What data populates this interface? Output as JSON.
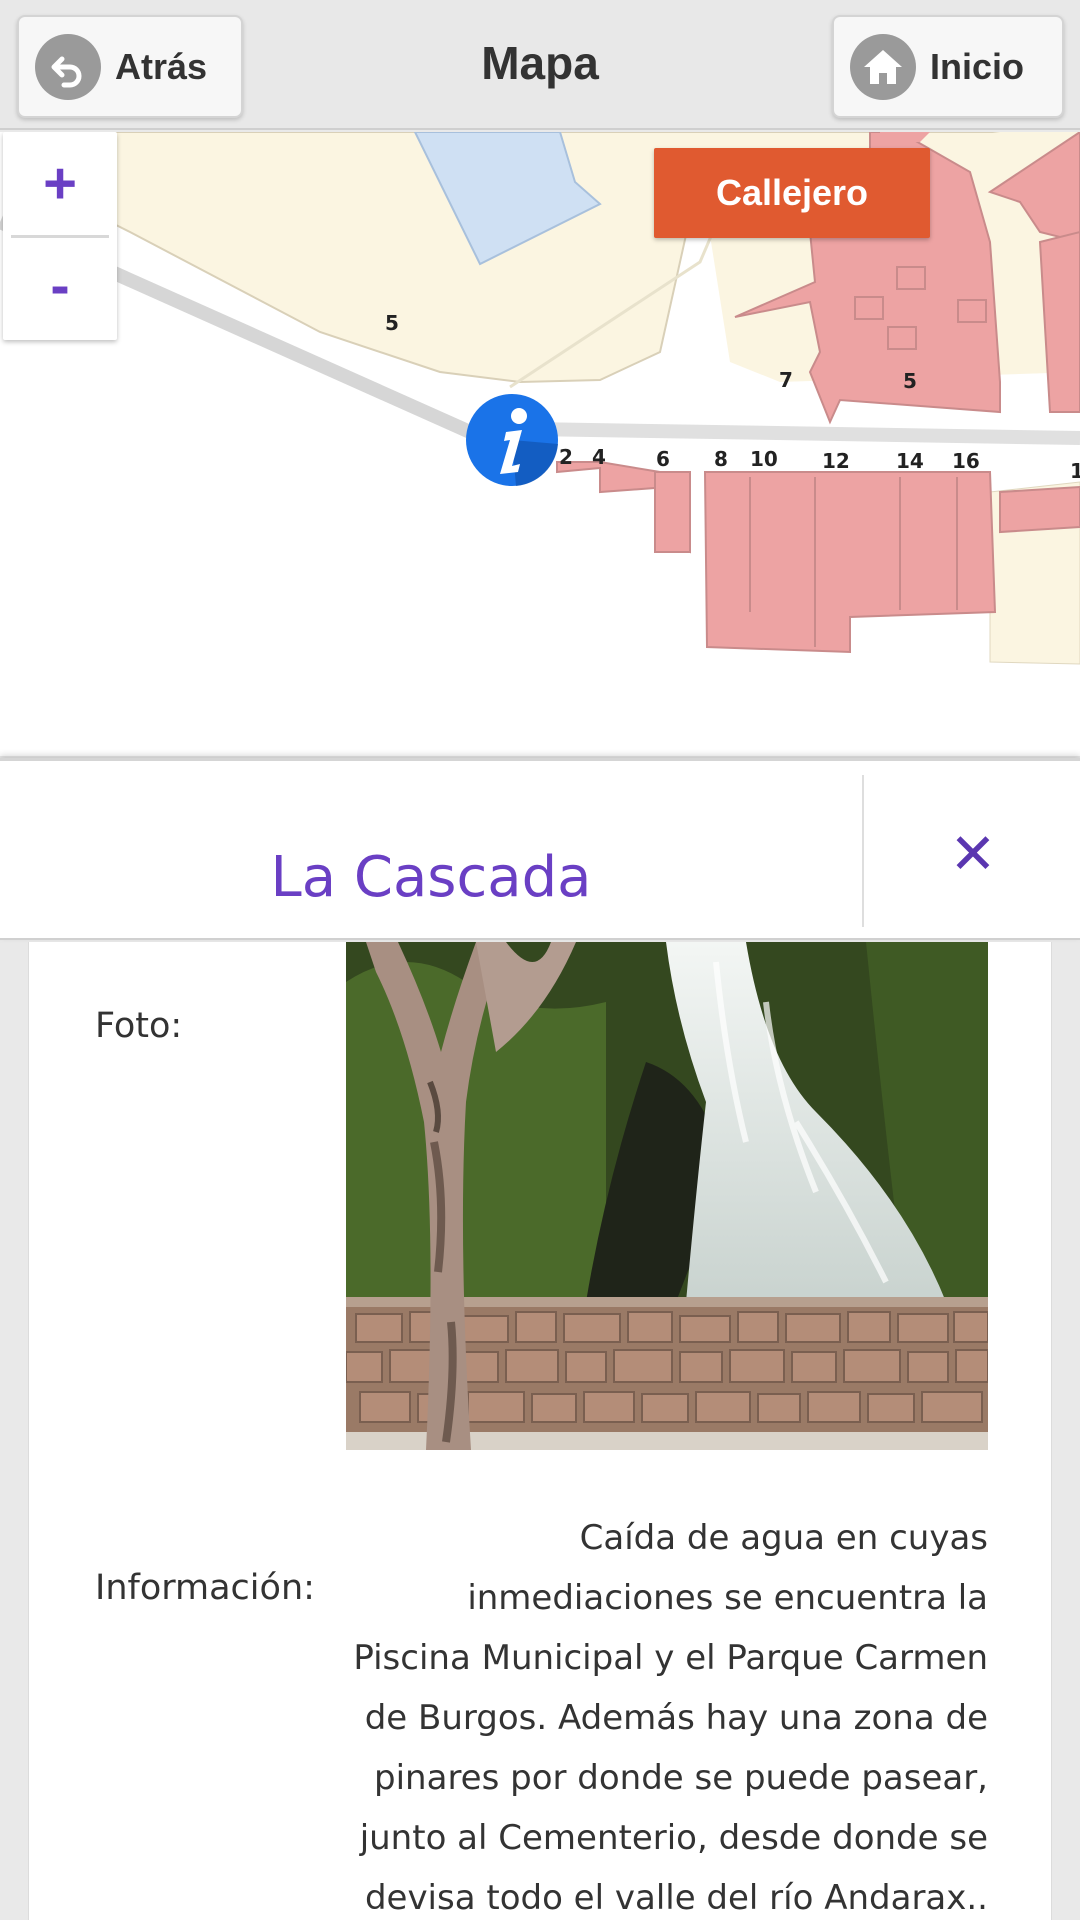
{
  "header": {
    "back_label": "Atrás",
    "title": "Mapa",
    "home_label": "Inicio"
  },
  "map": {
    "zoom_in_label": "+",
    "zoom_out_label": "-",
    "layer_button_label": "Callejero",
    "street_numbers": [
      "5",
      "7",
      "5",
      "2",
      "4",
      "6",
      "8",
      "10",
      "12",
      "14",
      "16",
      "1"
    ]
  },
  "popup": {
    "title": "La Cascada",
    "close_icon": "close-icon",
    "photo_label": "Foto:",
    "info_label": "Información:",
    "info_text": "Caída de agua en cuyas inmediaciones se encuentra la Piscina Municipal y el Parque Carmen de Burgos. Además hay una zona de pinares por donde se puede pasear, junto al Cementerio, desde donde se devisa todo el valle del río Andarax.."
  },
  "colors": {
    "accent_purple": "#6a3fc4",
    "callejero_orange": "#e05a30",
    "building_pink": "#eda3a3",
    "land_cream": "#fbf5e1",
    "water_blue": "#cfe0f3",
    "marker_blue": "#1a73e8"
  }
}
